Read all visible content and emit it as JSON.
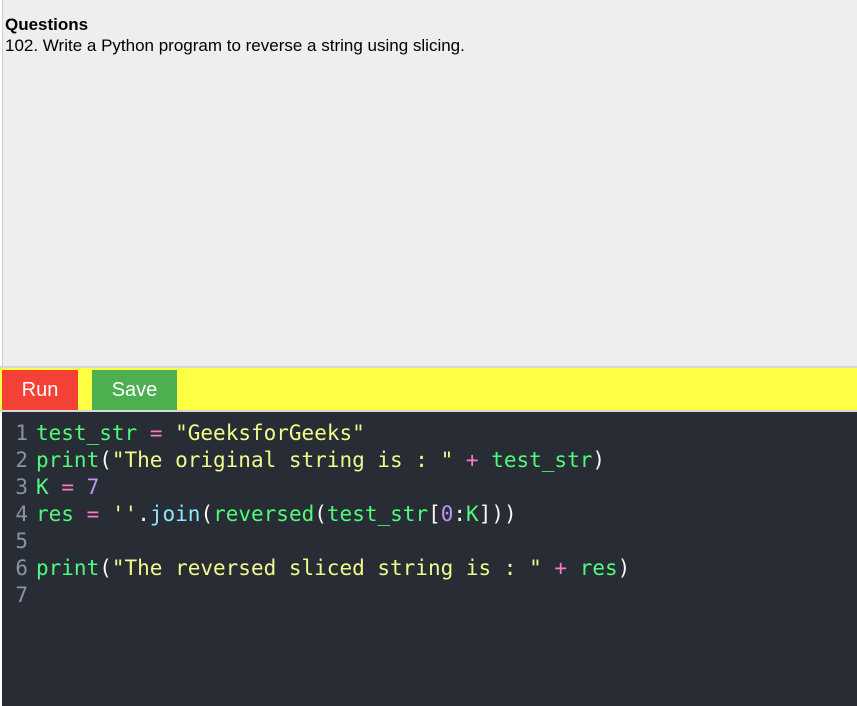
{
  "question": {
    "heading": "Questions",
    "text": "102. Write a Python program to reverse a string using slicing."
  },
  "toolbar": {
    "run_label": "Run",
    "save_label": "Save"
  },
  "editor": {
    "lines": [
      {
        "number": "1",
        "tokens": [
          {
            "t": "test_str",
            "k": "var"
          },
          {
            "t": " ",
            "k": "punc"
          },
          {
            "t": "=",
            "k": "op"
          },
          {
            "t": " ",
            "k": "punc"
          },
          {
            "t": "\"GeeksforGeeks\"",
            "k": "str"
          }
        ]
      },
      {
        "number": "2",
        "tokens": [
          {
            "t": "print",
            "k": "var"
          },
          {
            "t": "(",
            "k": "punc"
          },
          {
            "t": "\"The original string is : \"",
            "k": "str"
          },
          {
            "t": " ",
            "k": "punc"
          },
          {
            "t": "+",
            "k": "op"
          },
          {
            "t": " ",
            "k": "punc"
          },
          {
            "t": "test_str",
            "k": "var"
          },
          {
            "t": ")",
            "k": "punc"
          }
        ]
      },
      {
        "number": "3",
        "tokens": [
          {
            "t": "K",
            "k": "var"
          },
          {
            "t": " ",
            "k": "punc"
          },
          {
            "t": "=",
            "k": "op"
          },
          {
            "t": " ",
            "k": "punc"
          },
          {
            "t": "7",
            "k": "num"
          }
        ]
      },
      {
        "number": "4",
        "tokens": [
          {
            "t": "res",
            "k": "var"
          },
          {
            "t": " ",
            "k": "punc"
          },
          {
            "t": "=",
            "k": "op"
          },
          {
            "t": " ",
            "k": "punc"
          },
          {
            "t": "''",
            "k": "str"
          },
          {
            "t": ".",
            "k": "punc"
          },
          {
            "t": "join",
            "k": "fn"
          },
          {
            "t": "(",
            "k": "punc"
          },
          {
            "t": "reversed",
            "k": "var"
          },
          {
            "t": "(",
            "k": "punc"
          },
          {
            "t": "test_str",
            "k": "var"
          },
          {
            "t": "[",
            "k": "punc"
          },
          {
            "t": "0",
            "k": "num"
          },
          {
            "t": ":",
            "k": "punc"
          },
          {
            "t": "K",
            "k": "var"
          },
          {
            "t": "]))",
            "k": "punc"
          }
        ]
      },
      {
        "number": "5",
        "tokens": []
      },
      {
        "number": "6",
        "tokens": [
          {
            "t": "print",
            "k": "var"
          },
          {
            "t": "(",
            "k": "punc"
          },
          {
            "t": "\"The reversed sliced string is : \"",
            "k": "str"
          },
          {
            "t": " ",
            "k": "punc"
          },
          {
            "t": "+",
            "k": "op"
          },
          {
            "t": " ",
            "k": "punc"
          },
          {
            "t": "res",
            "k": "var"
          },
          {
            "t": ")",
            "k": "punc"
          }
        ]
      },
      {
        "number": "7",
        "tokens": []
      }
    ]
  },
  "colors": {
    "run_button": "#f44336",
    "save_button": "#4caf50",
    "toolbar_bg": "#ffff44",
    "editor_bg": "#282c34",
    "question_bg": "#eeeeee"
  }
}
